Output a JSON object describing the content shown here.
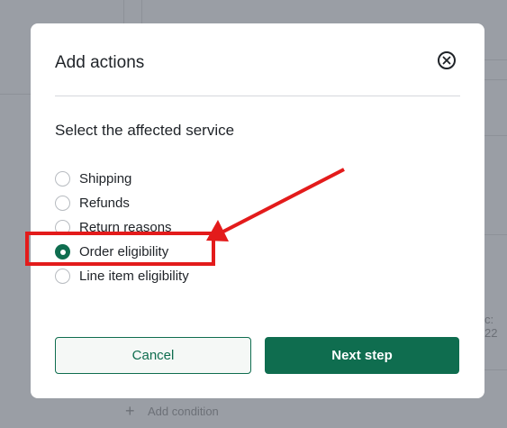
{
  "modal": {
    "title": "Add actions",
    "section_label": "Select the affected service",
    "options": [
      {
        "label": "Shipping",
        "checked": false
      },
      {
        "label": "Refunds",
        "checked": false
      },
      {
        "label": "Return reasons",
        "checked": false
      },
      {
        "label": "Order eligibility",
        "checked": true
      },
      {
        "label": "Line item eligibility",
        "checked": false
      }
    ],
    "cancel_label": "Cancel",
    "next_label": "Next step"
  },
  "background": {
    "add_condition_label": "Add condition",
    "partial_text": "c: 22"
  },
  "colors": {
    "primary": "#0f6d4f",
    "annotation": "#e31b1b",
    "overlay": "#9a9ea5"
  },
  "icons": {
    "close": "close-icon",
    "add": "plus-icon"
  }
}
